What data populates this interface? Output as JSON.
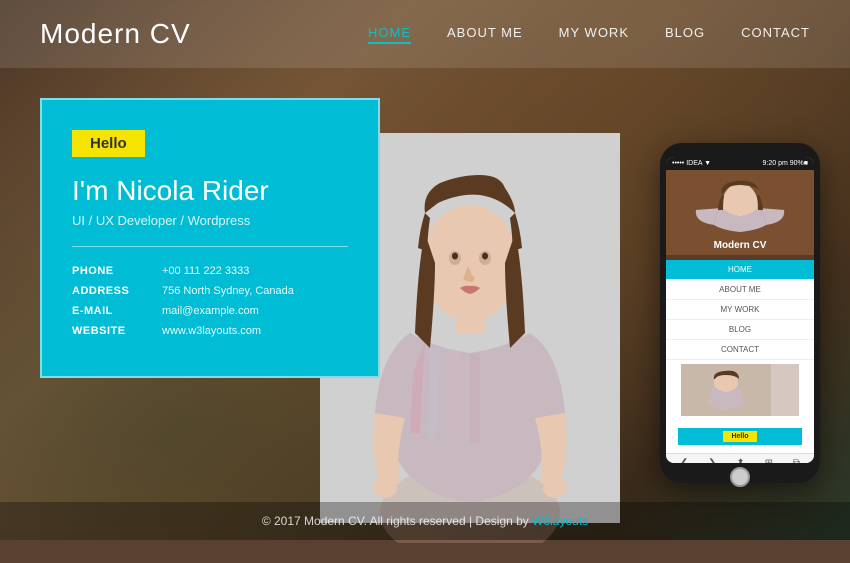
{
  "logo": "Modern CV",
  "nav": {
    "items": [
      {
        "label": "HOME",
        "active": true
      },
      {
        "label": "ABOUT ME",
        "active": false
      },
      {
        "label": "MY WORK",
        "active": false
      },
      {
        "label": "BLOG",
        "active": false
      },
      {
        "label": "CONTACT",
        "active": false
      }
    ]
  },
  "card": {
    "hello_badge": "Hello",
    "name": "I'm Nicola Rider",
    "tagline": "UI / UX Developer / Wordpress",
    "contact": [
      {
        "label": "PHONE",
        "value": "+00 111 222 3333"
      },
      {
        "label": "ADDRESS",
        "value": "756 North Sydney, Canada"
      },
      {
        "label": "E-MAIL",
        "value": "mail@example.com"
      },
      {
        "label": "WEBSITE",
        "value": "www.w3layouts.com"
      }
    ]
  },
  "phone": {
    "status_left": "••••• IDEA ▼",
    "status_right": "9:20 pm  90% ■",
    "title": "Modern CV",
    "nav_items": [
      "HOME",
      "ABOUT ME",
      "MY WORK",
      "BLOG",
      "CONTACT"
    ],
    "hello_label": "Hello"
  },
  "footer": {
    "text": "© 2017 Modern CV. All rights reserved | Design by ",
    "link_text": "W3layouts"
  }
}
